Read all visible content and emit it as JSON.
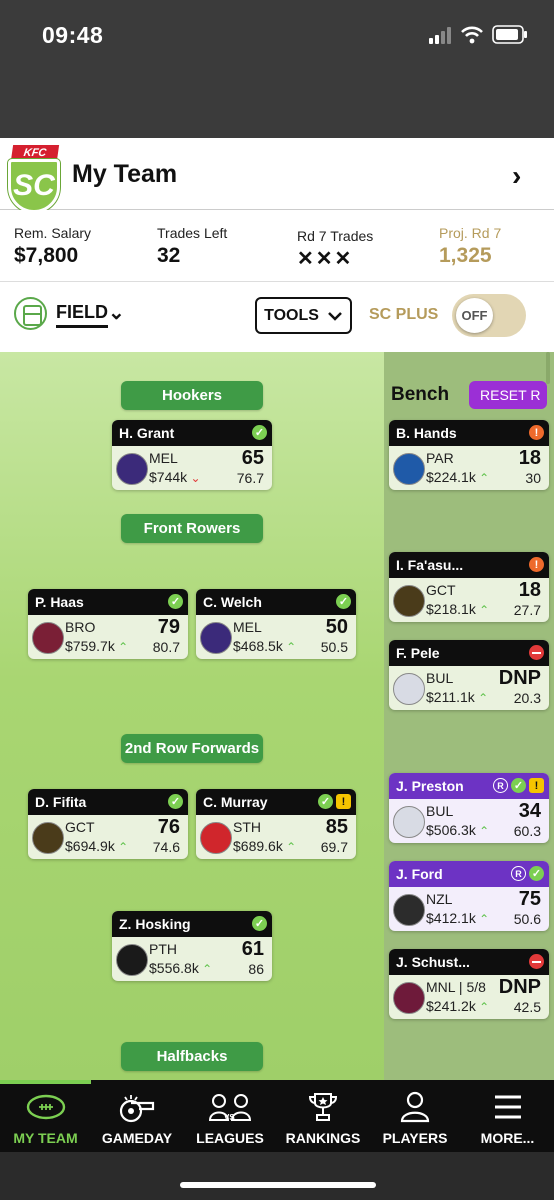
{
  "status": {
    "time": "09:48"
  },
  "header": {
    "logo_text": "SC",
    "logo_brand": "KFC",
    "title": "My Team"
  },
  "stats": {
    "salary_label": "Rem. Salary",
    "salary_value": "$7,800",
    "trades_label": "Trades Left",
    "trades_value": "32",
    "rd_trades_label": "Rd 7 Trades",
    "rd_trades_value": "✕✕✕",
    "proj_label": "Proj. Rd 7",
    "proj_value": "1,325"
  },
  "toolbar": {
    "field_label": "FIELD",
    "tools_label": "TOOLS",
    "scplus_label": "SC PLUS",
    "toggle_label": "OFF"
  },
  "positions": {
    "hookers": "Hookers",
    "front_rowers": "Front Rowers",
    "second_row": "2nd Row Forwards",
    "halfbacks": "Halfbacks"
  },
  "bench": {
    "label": "Bench",
    "reset_label": "RESET R"
  },
  "players": [
    {
      "name": "H. Grant",
      "team": "MEL",
      "price": "$744k",
      "trend": "down",
      "score": "65",
      "avg": "76.7",
      "status": "ok"
    },
    {
      "name": "P. Haas",
      "team": "BRO",
      "price": "$759.7k",
      "trend": "up",
      "score": "79",
      "avg": "80.7",
      "status": "ok"
    },
    {
      "name": "C. Welch",
      "team": "MEL",
      "price": "$468.5k",
      "trend": "up",
      "score": "50",
      "avg": "50.5",
      "status": "ok"
    },
    {
      "name": "D. Fifita",
      "team": "GCT",
      "price": "$694.9k",
      "trend": "up",
      "score": "76",
      "avg": "74.6",
      "status": "ok"
    },
    {
      "name": "C. Murray",
      "team": "STH",
      "price": "$689.6k",
      "trend": "up",
      "score": "85",
      "avg": "69.7",
      "status": "ok-warn"
    },
    {
      "name": "Z. Hosking",
      "team": "PTH",
      "price": "$556.8k",
      "trend": "up",
      "score": "61",
      "avg": "86",
      "status": "ok"
    },
    {
      "name": "B. Hands",
      "team": "PAR",
      "price": "$224.1k",
      "trend": "up",
      "score": "18",
      "avg": "30",
      "status": "injured"
    },
    {
      "name": "I. Fa'asu...",
      "team": "GCT",
      "price": "$218.1k",
      "trend": "up",
      "score": "18",
      "avg": "27.7",
      "status": "injured"
    },
    {
      "name": "F. Pele",
      "team": "BUL",
      "price": "$211.1k",
      "trend": "up",
      "score": "DNP",
      "avg": "20.3",
      "status": "dnp"
    },
    {
      "name": "J. Preston",
      "team": "BUL",
      "price": "$506.3k",
      "trend": "up",
      "score": "34",
      "avg": "60.3",
      "status": "reserve-ok-warn"
    },
    {
      "name": "J. Ford",
      "team": "NZL",
      "price": "$412.1k",
      "trend": "up",
      "score": "75",
      "avg": "50.6",
      "status": "reserve-ok"
    },
    {
      "name": "J. Schust...",
      "team": "MNL | 5/8",
      "price": "$241.2k",
      "trend": "up",
      "score": "DNP",
      "avg": "42.5",
      "status": "dnp"
    }
  ],
  "tabs": [
    "MY TEAM",
    "GAMEDAY",
    "LEAGUES",
    "RANKINGS",
    "PLAYERS",
    "MORE..."
  ],
  "colors": {
    "accent_green": "#3f9b46",
    "active_tab": "#7ccf52",
    "gold": "#b59b5b",
    "purple": "#6d33c4",
    "reset_purple": "#9b2fd6"
  }
}
